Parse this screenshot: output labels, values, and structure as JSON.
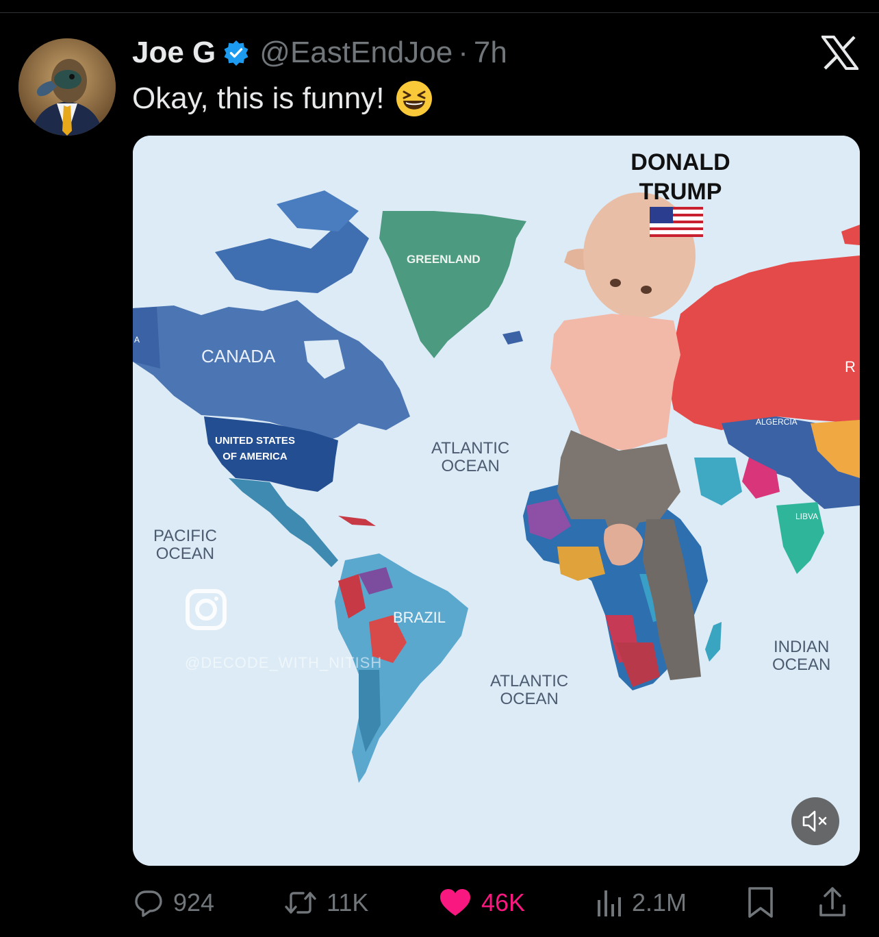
{
  "tweet": {
    "author_name": "Joe G",
    "handle": "@EastEndJoe",
    "separator": "·",
    "time": "7h",
    "text": "Okay, this is funny!",
    "emoji": "laughing-face-emoji",
    "verified": true
  },
  "media": {
    "overlay_title": "DONALD TRUMP",
    "overlay_line1": "DONALD",
    "overlay_line2": "TRUMP",
    "watermark": "@DECODE_WITH_NITISH",
    "labels": {
      "greenland": "GREENLAND",
      "canada": "CANADA",
      "usa_line1": "UNITED STATES",
      "usa_line2": "OF AMERICA",
      "pacific_line1": "PACIFIC",
      "pacific_line2": "OCEAN",
      "atlantic_n_line1": "ATLANTIC",
      "atlantic_n_line2": "OCEAN",
      "atlantic_s_line1": "ATLANTIC",
      "atlantic_s_line2": "OCEAN",
      "brazil": "BRAZIL",
      "indian_line1": "INDIAN",
      "indian_line2": "OCEAN",
      "algeria": "ALGERCIA",
      "libya": "LIBVA",
      "edge_left": "A",
      "edge_right": "R"
    },
    "muted": true
  },
  "actions": {
    "replies": "924",
    "retweets": "11K",
    "likes": "46K",
    "views": "2.1M"
  },
  "colors": {
    "background": "#000000",
    "verified_blue": "#1d9bf0",
    "like_pink": "#f91880",
    "muted_text": "#71767b"
  }
}
